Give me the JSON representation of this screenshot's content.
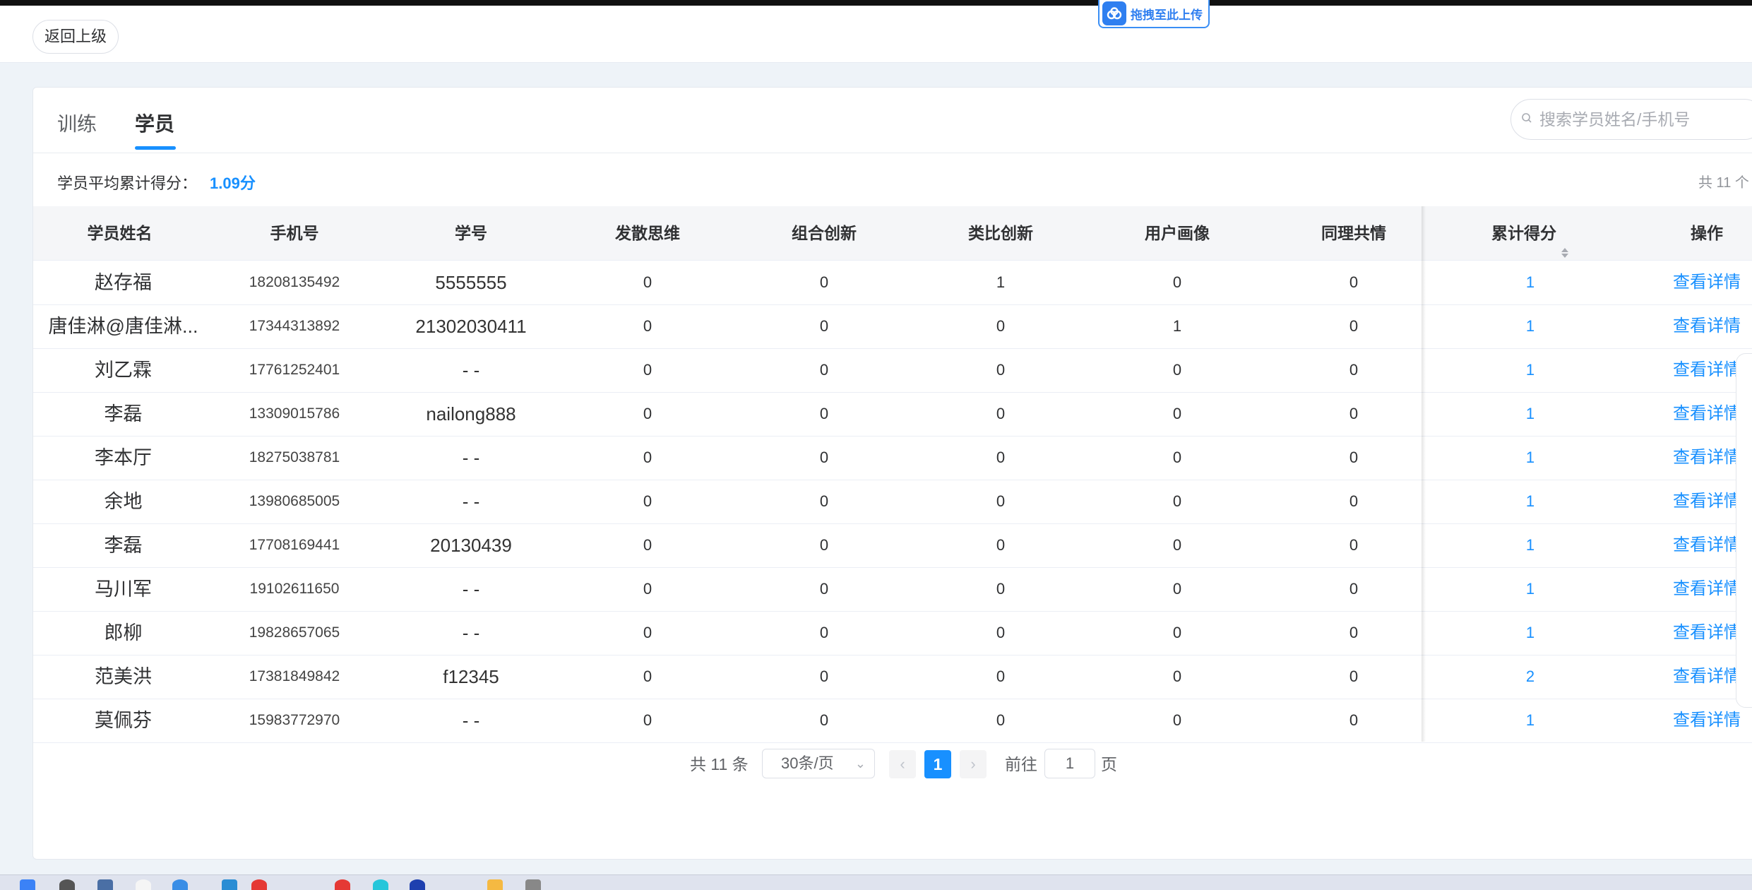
{
  "header": {
    "back_label": "返回上级",
    "upload_label": "拖拽至此上传"
  },
  "tabs": [
    {
      "label": "训练"
    },
    {
      "label": "学员",
      "active": true
    }
  ],
  "search": {
    "placeholder": "搜索学员姓名/手机号"
  },
  "summary": {
    "avg_label": "学员平均累计得分：",
    "avg_value": "1.09分",
    "total_right": "共 11 个"
  },
  "table": {
    "columns": [
      "学员姓名",
      "手机号",
      "学号",
      "发散思维",
      "组合创新",
      "类比创新",
      "用户画像",
      "同理共情",
      "累计得分",
      "操作"
    ],
    "rows": [
      [
        "赵存福",
        "18208135492",
        "5555555",
        "0",
        "0",
        "1",
        "0",
        "0",
        "1",
        "查看详情"
      ],
      [
        "唐佳淋@唐佳淋...",
        "17344313892",
        "21302030411",
        "0",
        "0",
        "0",
        "1",
        "0",
        "1",
        "查看详情"
      ],
      [
        "刘乙霖",
        "17761252401",
        "- -",
        "0",
        "0",
        "0",
        "0",
        "0",
        "1",
        "查看详情"
      ],
      [
        "李磊",
        "13309015786",
        "nailong888",
        "0",
        "0",
        "0",
        "0",
        "0",
        "1",
        "查看详情"
      ],
      [
        "李本厅",
        "18275038781",
        "- -",
        "0",
        "0",
        "0",
        "0",
        "0",
        "1",
        "查看详情"
      ],
      [
        "余地",
        "13980685005",
        "- -",
        "0",
        "0",
        "0",
        "0",
        "0",
        "1",
        "查看详情"
      ],
      [
        "李磊",
        "17708169441",
        "20130439",
        "0",
        "0",
        "0",
        "0",
        "0",
        "1",
        "查看详情"
      ],
      [
        "马川军",
        "19102611650",
        "- -",
        "0",
        "0",
        "0",
        "0",
        "0",
        "1",
        "查看详情"
      ],
      [
        "郎柳",
        "19828657065",
        "- -",
        "0",
        "0",
        "0",
        "0",
        "0",
        "1",
        "查看详情"
      ],
      [
        "范美洪",
        "17381849842",
        "f12345",
        "0",
        "0",
        "0",
        "0",
        "0",
        "2",
        "查看详情"
      ],
      [
        "莫佩芬",
        "15983772970",
        "- -",
        "0",
        "0",
        "0",
        "0",
        "0",
        "1",
        "查看详情"
      ]
    ]
  },
  "pagination": {
    "total": "共 11 条",
    "page_size": "30条/页",
    "current_page": "1",
    "goto_label": "前往",
    "goto_value": "1",
    "unit": "页",
    "prev": "‹",
    "next": "›"
  },
  "colors": {
    "accent": "#1890ff"
  }
}
